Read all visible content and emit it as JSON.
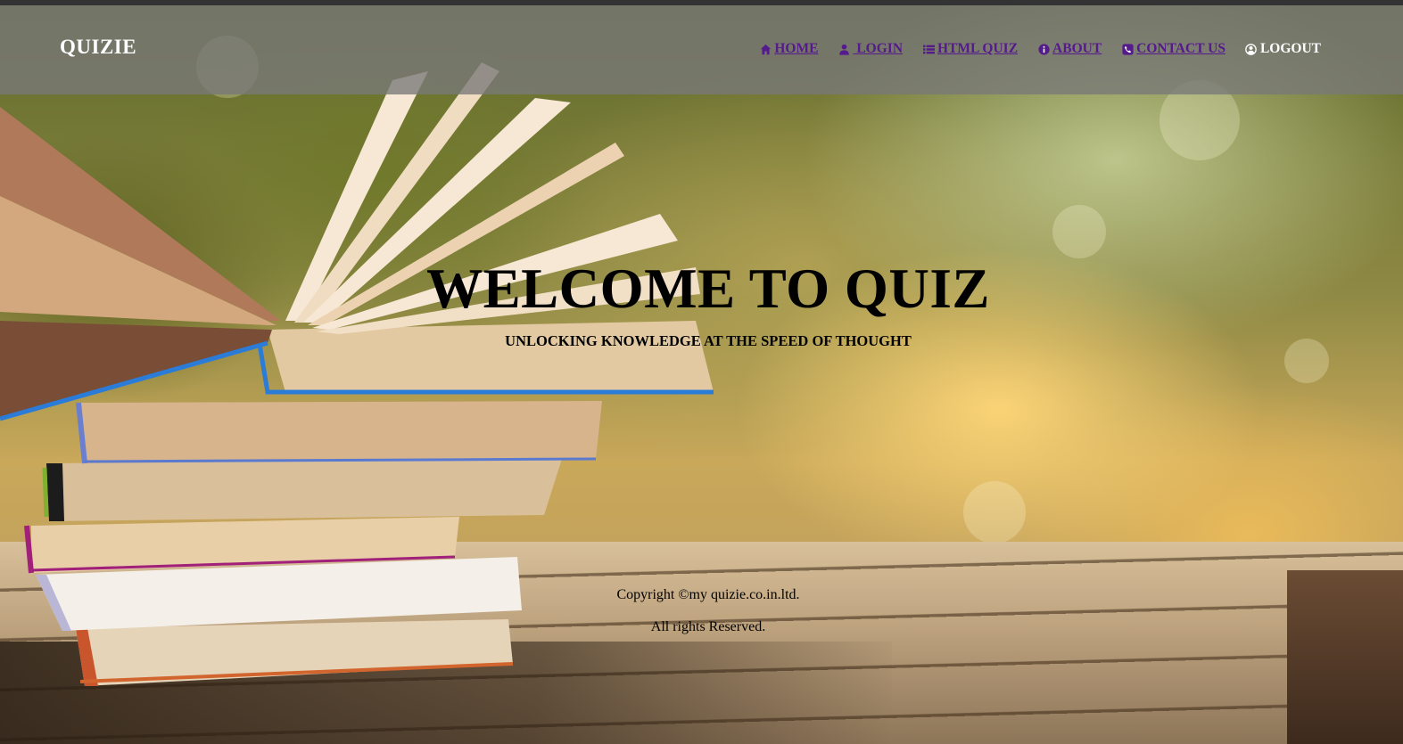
{
  "brand": {
    "name": "QUIZIE"
  },
  "nav": {
    "items": [
      {
        "label": "HOME",
        "icon": "home-icon"
      },
      {
        "label": " LOGIN",
        "icon": "user-icon"
      },
      {
        "label": "HTML QUIZ",
        "icon": "list-icon"
      },
      {
        "label": "ABOUT",
        "icon": "info-icon"
      },
      {
        "label": "CONTACT US",
        "icon": "phone-icon"
      },
      {
        "label": "LOGOUT",
        "icon": "user-circle-icon"
      }
    ],
    "link_color": "#551a8b",
    "logout_color": "#ffffff"
  },
  "hero": {
    "title": "WELCOME TO QUIZ",
    "subtitle": "UNLOCKING KNOWLEDGE AT THE SPEED OF THOUGHT"
  },
  "footer": {
    "copyright": "Copyright ©my quizie.co.in.ltd.",
    "rights": "All rights Reserved."
  }
}
